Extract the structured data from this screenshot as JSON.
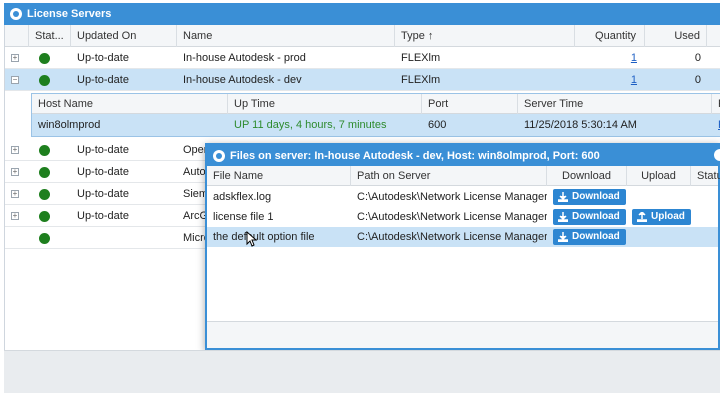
{
  "window": {
    "title": "License Servers"
  },
  "grid": {
    "columns": [
      "Stat...",
      "Updated On",
      "Name",
      "Type ↑",
      "Quantity",
      "Used"
    ],
    "rows": [
      {
        "updated": "Up-to-date",
        "name": "In-house Autodesk - prod",
        "type": "FLEXlm",
        "quantity": "1",
        "used": "0",
        "expander": "+"
      },
      {
        "updated": "Up-to-date",
        "name": "In-house Autodesk - dev",
        "type": "FLEXlm",
        "quantity": "1",
        "used": "0",
        "expander": "−"
      },
      {
        "updated": "Up-to-date",
        "name": "OpenL",
        "expander": "+"
      },
      {
        "updated": "Up-to-date",
        "name": "Autode",
        "expander": "+"
      },
      {
        "updated": "Up-to-date",
        "name": "Sieme",
        "expander": "+"
      },
      {
        "updated": "Up-to-date",
        "name": "ArcGIS",
        "expander": "+"
      },
      {
        "updated": "",
        "name": "Micros",
        "expander": ""
      }
    ]
  },
  "subgrid": {
    "columns": [
      "Host Name",
      "Up Time",
      "Port",
      "Server Time",
      "Fi"
    ],
    "row": {
      "host": "win8olmprod",
      "uptime": "UP 11 days, 4 hours, 7 minutes",
      "port": "600",
      "server_time": "11/25/2018 5:30:14 AM",
      "fi": "Fi"
    }
  },
  "modal": {
    "title": "Files on server: In-house Autodesk - dev, Host: win8olmprod, Port: 600",
    "columns": [
      "File Name",
      "Path on Server",
      "Download",
      "Upload",
      "Statu"
    ],
    "download_label": "Download",
    "upload_label": "Upload",
    "files": [
      {
        "name": "adskflex.log",
        "path": "C:\\Autodesk\\Network License Manager\\a..."
      },
      {
        "name": "license file 1",
        "path": "C:\\Autodesk\\Network License Manager\\w..."
      },
      {
        "name": "the default option file",
        "path": "C:\\Autodesk\\Network License Manager\\a..."
      }
    ]
  },
  "colors": {
    "accent": "#3a8fd6",
    "button": "#2d86d2",
    "status_ok": "#1e7f1e",
    "selected_row": "#c9e2f6"
  }
}
